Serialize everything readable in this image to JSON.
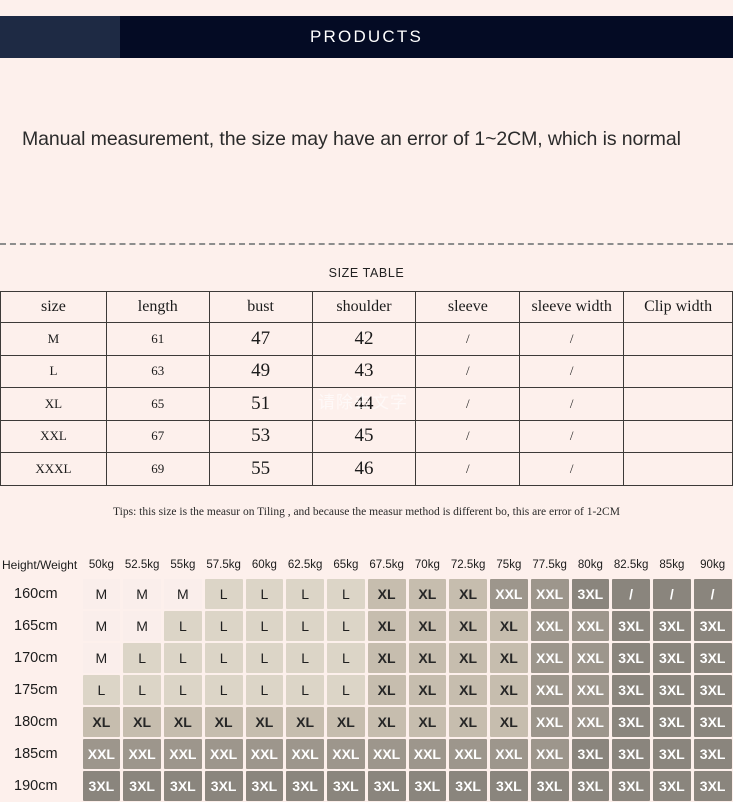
{
  "banner": {
    "title": "PRODUCTS",
    "left_color": "#1e2a44",
    "main_color": "#040b24"
  },
  "intro": {
    "text": "Manual measurement, the size may have an error of 1~2CM, which is normal"
  },
  "size_table": {
    "caption": "SIZE TABLE",
    "columns": [
      "size",
      "length",
      "bust",
      "shoulder",
      "sleeve",
      "sleeve width",
      "Clip width"
    ],
    "rows": [
      {
        "size": "M",
        "length": "61",
        "bust": "47",
        "shoulder": "42",
        "sleeve": "/",
        "sleeve_width": "/",
        "clip_width": ""
      },
      {
        "size": "L",
        "length": "63",
        "bust": "49",
        "shoulder": "43",
        "sleeve": "/",
        "sleeve_width": "/",
        "clip_width": ""
      },
      {
        "size": "XL",
        "length": "65",
        "bust": "51",
        "shoulder": "44",
        "sleeve": "/",
        "sleeve_width": "/",
        "clip_width": ""
      },
      {
        "size": "XXL",
        "length": "67",
        "bust": "53",
        "shoulder": "45",
        "sleeve": "/",
        "sleeve_width": "/",
        "clip_width": ""
      },
      {
        "size": "XXXL",
        "length": "69",
        "bust": "55",
        "shoulder": "46",
        "sleeve": "/",
        "sleeve_width": "/",
        "clip_width": ""
      }
    ],
    "watermark": "请除去文字"
  },
  "tips": {
    "text": "Tips: this size is the measur on Tiling , and because the measur method is different bo, this are error of 1-2CM"
  },
  "hw_grid": {
    "corner_label": "Height/Weight",
    "weights": [
      "50kg",
      "52.5kg",
      "55kg",
      "57.5kg",
      "60kg",
      "62.5kg",
      "65kg",
      "67.5kg",
      "70kg",
      "72.5kg",
      "75kg",
      "77.5kg",
      "80kg",
      "82.5kg",
      "85kg",
      "90kg"
    ],
    "heights": [
      "160cm",
      "165cm",
      "170cm",
      "175cm",
      "180cm",
      "185cm",
      "190cm"
    ],
    "cells": [
      [
        "M",
        "M",
        "M",
        "L",
        "L",
        "L",
        "L",
        "XL",
        "XL",
        "XL",
        "XXL",
        "XXL",
        "3XL",
        "/",
        "/",
        "/"
      ],
      [
        "M",
        "M",
        "L",
        "L",
        "L",
        "L",
        "L",
        "XL",
        "XL",
        "XL",
        "XL",
        "XXL",
        "XXL",
        "3XL",
        "3XL",
        "3XL"
      ],
      [
        "M",
        "L",
        "L",
        "L",
        "L",
        "L",
        "L",
        "XL",
        "XL",
        "XL",
        "XL",
        "XXL",
        "XXL",
        "3XL",
        "3XL",
        "3XL"
      ],
      [
        "L",
        "L",
        "L",
        "L",
        "L",
        "L",
        "L",
        "XL",
        "XL",
        "XL",
        "XL",
        "XXL",
        "XXL",
        "3XL",
        "3XL",
        "3XL"
      ],
      [
        "XL",
        "XL",
        "XL",
        "XL",
        "XL",
        "XL",
        "XL",
        "XL",
        "XL",
        "XL",
        "XL",
        "XXL",
        "XXL",
        "3XL",
        "3XL",
        "3XL"
      ],
      [
        "XXL",
        "XXL",
        "XXL",
        "XXL",
        "XXL",
        "XXL",
        "XXL",
        "XXL",
        "XXL",
        "XXL",
        "XXL",
        "XXL",
        "3XL",
        "3XL",
        "3XL",
        "3XL"
      ],
      [
        "3XL",
        "3XL",
        "3XL",
        "3XL",
        "3XL",
        "3XL",
        "3XL",
        "3XL",
        "3XL",
        "3XL",
        "3XL",
        "3XL",
        "3XL",
        "3XL",
        "3XL",
        "3XL"
      ]
    ],
    "legend_colors": {
      "M": "#faeeeb",
      "L": "#dcd5c7",
      "XL": "#c6bdae",
      "XXL": "#9d968c",
      "3XL": "#8a857d"
    }
  },
  "page": {
    "background": "#fdf0ec"
  }
}
